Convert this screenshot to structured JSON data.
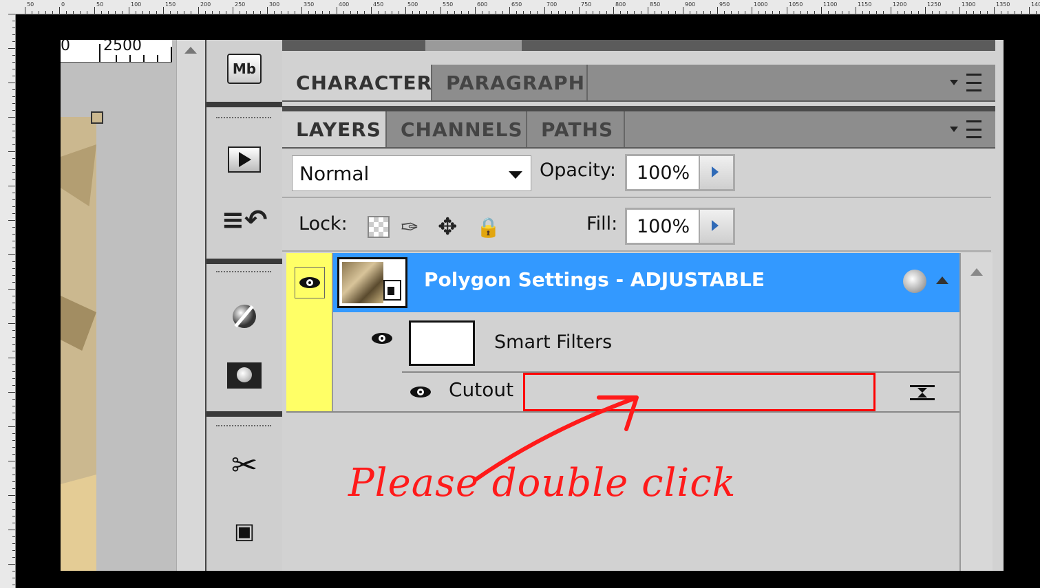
{
  "ruler": {
    "top_labels": [
      "50",
      "0",
      "50",
      "100",
      "150",
      "200",
      "250",
      "300",
      "350",
      "400",
      "450",
      "500",
      "550",
      "600",
      "650",
      "700",
      "750",
      "800",
      "850",
      "900",
      "950",
      "1000",
      "1050",
      "1100",
      "1150",
      "1200",
      "1250",
      "1300",
      "1350",
      "140"
    ]
  },
  "canvas": {
    "ruler_numbers": [
      "0",
      "2500"
    ]
  },
  "dock": {
    "icons": [
      "mini-bridge-icon",
      "actions-play-icon",
      "history-icon",
      "brush-preset-icon",
      "mask-icon",
      "tools-icon",
      "3d-cube-icon"
    ],
    "mini_bridge_label": "Mb"
  },
  "panels": {
    "char_tabs": [
      "CHARACTER",
      "PARAGRAPH"
    ],
    "layer_tabs": [
      "LAYERS",
      "CHANNELS",
      "PATHS"
    ],
    "blend_mode": "Normal",
    "opacity_label": "Opacity:",
    "opacity_value": "100%",
    "lock_label": "Lock:",
    "fill_label": "Fill:",
    "fill_value": "100%"
  },
  "layers": {
    "selected_layer": "Polygon Settings - ADJUSTABLE",
    "smart_filters": "Smart Filters",
    "filter_name": "Cutout"
  },
  "annotation": {
    "text": "Please double click",
    "color": "#ff1a1a"
  },
  "colors": {
    "selection": "#3399ff",
    "visibility_column": "#ffff66",
    "highlight": "#ff0000"
  }
}
